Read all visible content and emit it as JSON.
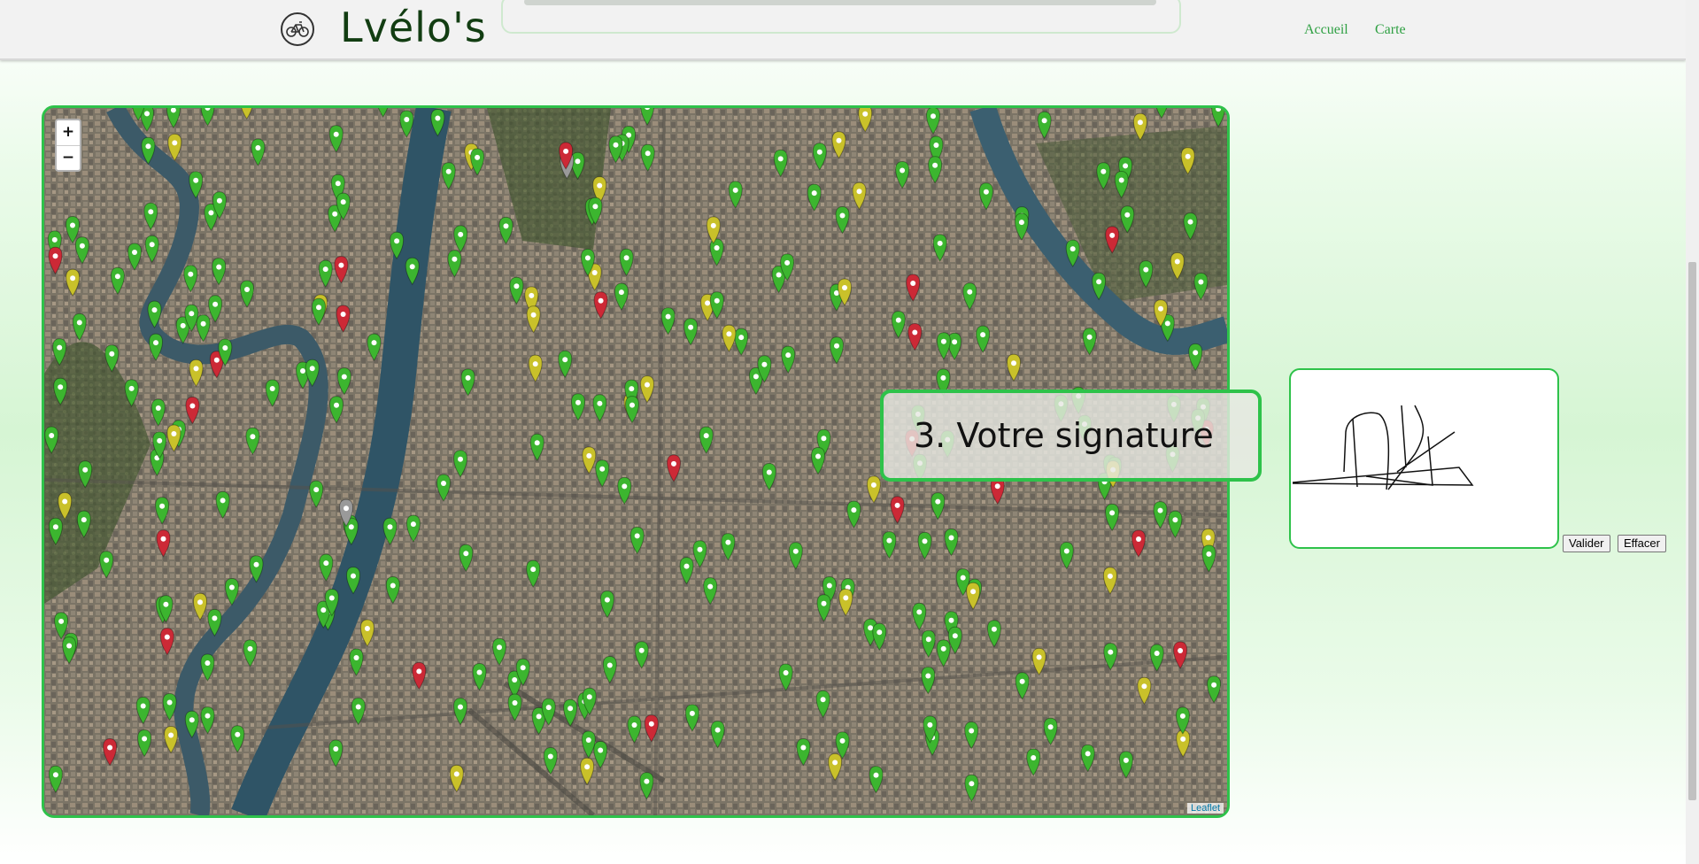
{
  "header": {
    "brand": "Lvélo's",
    "logo_icon": "bicycle-icon",
    "nav": [
      {
        "label": "Accueil"
      },
      {
        "label": "Carte"
      }
    ]
  },
  "map": {
    "zoom_in": "+",
    "zoom_out": "−",
    "attribution": "Leaflet",
    "marker_colors": {
      "available": "#3cb52f",
      "low": "#c9c12a",
      "empty": "#cc2936",
      "closed": "#9a9a9a"
    }
  },
  "reservation": {
    "step_title": "3. Votre signature",
    "validate_label": "Valider",
    "clear_label": "Effacer"
  },
  "accent_color": "#2ec24a"
}
